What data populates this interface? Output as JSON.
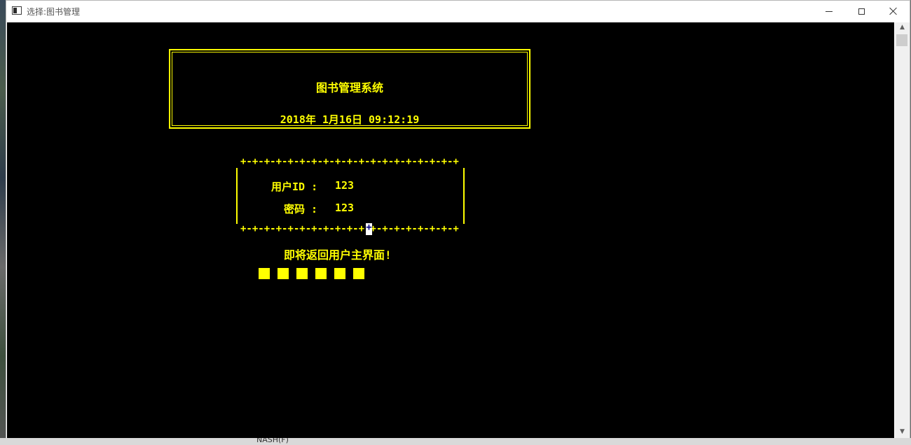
{
  "window": {
    "title": "选择:图书管理"
  },
  "header": {
    "system_title": "图书管理系统",
    "datetime": "2018年 1月16日 09:12:19"
  },
  "login": {
    "border_pattern": "+-+-+-+-+-+-+-+-+-+-+-+-+-+-+-+-+-+-+",
    "userid_label": "用户ID :",
    "userid_value": "123",
    "password_label": "密码 :",
    "password_value": "123"
  },
  "message": "即将返回用户主界面!",
  "progress": {
    "blocks_filled": 6
  },
  "taskbar": {
    "peek_item": "NASH(F)"
  },
  "colors": {
    "console_background": "#000000",
    "console_text": "#ffff00"
  }
}
